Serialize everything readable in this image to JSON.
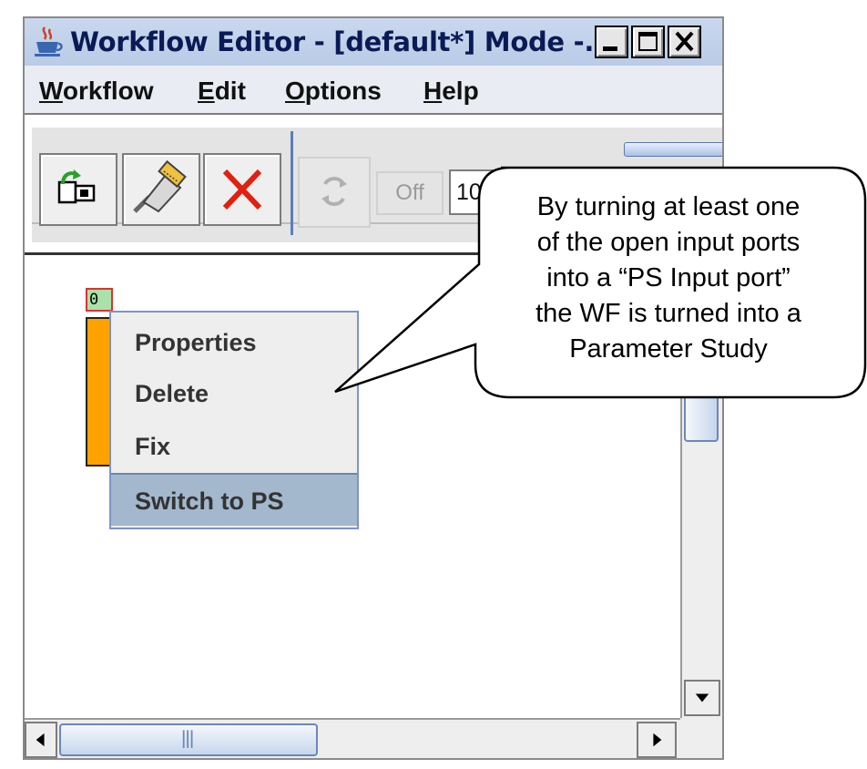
{
  "window": {
    "title": "Workflow Editor - [default*]  Mode -...",
    "app_icon": "java-cup-icon"
  },
  "menubar": {
    "items": [
      {
        "label": "Workflow",
        "mnemonic": "W"
      },
      {
        "label": "Edit",
        "mnemonic": "E"
      },
      {
        "label": "Options",
        "mnemonic": "O"
      },
      {
        "label": "Help",
        "mnemonic": "H"
      }
    ]
  },
  "toolbar": {
    "open_icon": "open-folder-icon",
    "connect_icon": "plug-icon",
    "delete_icon": "red-x-icon",
    "refresh_icon": "refresh-icon",
    "off_label": "Off",
    "zoom_value": "100"
  },
  "canvas": {
    "port_label": "0",
    "job_color": "#ffa200"
  },
  "context_menu": {
    "items": [
      "Properties",
      "Delete",
      "Fix",
      "Switch to PS"
    ],
    "selected": "Switch to PS"
  },
  "callout": {
    "lines": [
      "By turning at least one",
      "of the open input ports",
      "into a “PS Input port”",
      "the WF is turned into a",
      "Parameter Study"
    ]
  }
}
